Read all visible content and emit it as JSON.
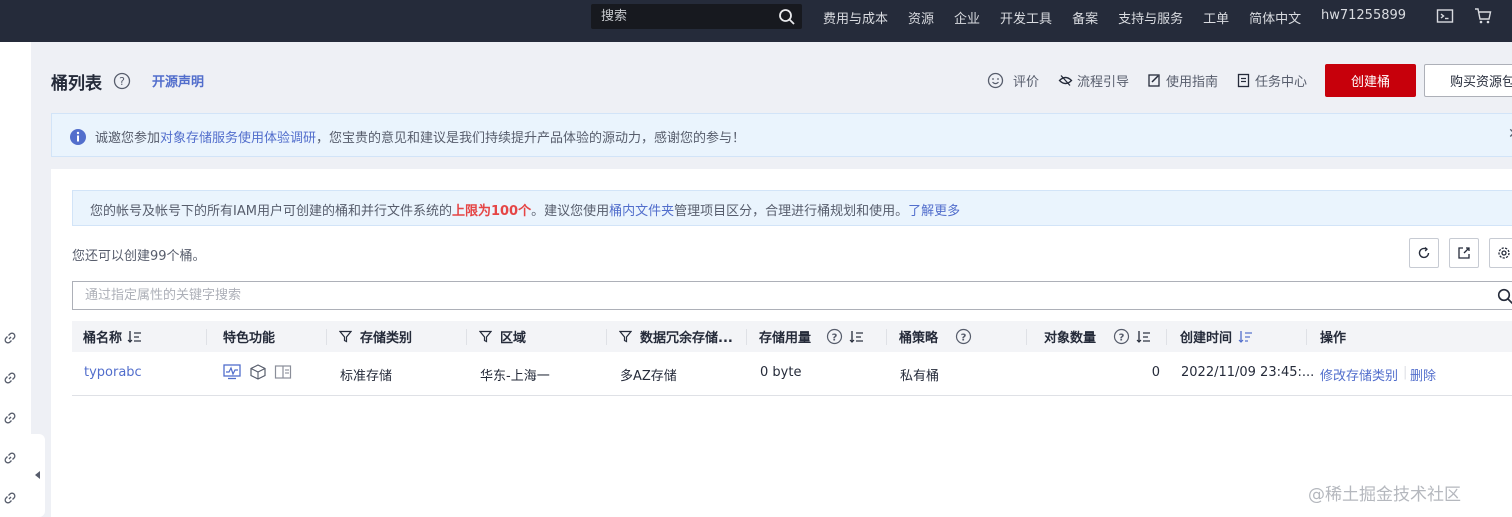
{
  "topbar": {
    "search_placeholder": "搜索",
    "nav": [
      "费用与成本",
      "资源",
      "企业",
      "开发工具",
      "备案",
      "支持与服务",
      "工单",
      "简体中文"
    ],
    "user": "hw71255899",
    "icons": [
      "terminal-icon",
      "cart-icon"
    ]
  },
  "header": {
    "title": "桶列表",
    "open_source": "开源声明",
    "links": [
      {
        "label": "评价",
        "icon": "smile-icon"
      },
      {
        "label": "流程引导",
        "icon": "eye-slash-icon"
      },
      {
        "label": "使用指南",
        "icon": "edit-doc-icon"
      },
      {
        "label": "任务中心",
        "icon": "task-list-icon"
      }
    ],
    "create_button": "创建桶",
    "buy_button": "购买资源包"
  },
  "notice": {
    "prefix": "诚邀您参加",
    "link": "对象存储服务使用体验调研",
    "suffix": "，您宝贵的意见和建议是我们持续提升产品体验的源动力，感谢您的参与！",
    "close": "✕"
  },
  "limit_info": {
    "part1": "您的帐号及帐号下的所有IAM用户可创建的桶和并行文件系统的",
    "highlight": "上限为100个",
    "part2": "。建议您使用",
    "link1": "桶内文件夹",
    "part3": "管理项目区分，合理进行桶规划和使用。",
    "link2": "了解更多"
  },
  "remaining_text": "您还可以创建99个桶。",
  "filter_placeholder": "通过指定属性的关键字搜索",
  "table": {
    "columns": [
      "桶名称",
      "特色功能",
      "存储类别",
      "区域",
      "数据冗余存储...",
      "存储用量",
      "桶策略",
      "对象数量",
      "创建时间",
      "操作"
    ],
    "rows": [
      {
        "name": "typorabc",
        "storage_class": "标准存储",
        "region": "华东-上海一",
        "redundancy": "多AZ存储",
        "usage": "0 byte",
        "policy": "私有桶",
        "object_count": "0",
        "created": "2022/11/09 23:45:...",
        "action_modify": "修改存储类别",
        "action_delete": "删除"
      }
    ]
  },
  "watermark": "@稀土掘金技术社区",
  "colors": {
    "topbar": "#252b3a",
    "primary": "#c7000b",
    "link": "#526ecc",
    "highlight": "#e54545"
  }
}
